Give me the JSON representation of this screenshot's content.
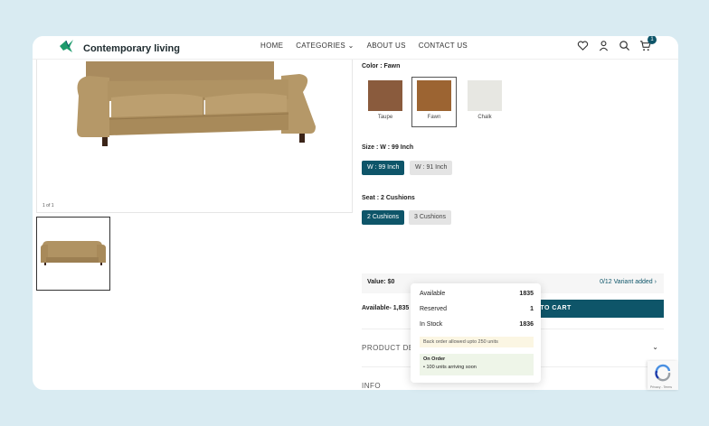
{
  "header": {
    "brand": "Contemporary living",
    "nav": [
      "HOME",
      "CATEGORIES",
      "ABOUT US",
      "CONTACT US"
    ],
    "cart_count": "1",
    "icons": [
      "wishlist-heart-icon",
      "user-icon",
      "search-icon",
      "cart-icon"
    ]
  },
  "gallery": {
    "page_indicator": "1 of 1"
  },
  "color": {
    "label": "Color : Fawn",
    "swatches": [
      {
        "name": "Taupe",
        "hex": "#8a5b3d",
        "selected": false
      },
      {
        "name": "Fawn",
        "hex": "#9c6432",
        "selected": true
      },
      {
        "name": "Chalk",
        "hex": "#e7e7e2",
        "selected": false
      }
    ]
  },
  "size": {
    "label": "Size : W : 99 Inch",
    "options": [
      "W : 99 Inch",
      "W : 91 Inch"
    ]
  },
  "seat": {
    "label": "Seat : 2 Cushions",
    "options": [
      "2 Cushions",
      "3 Cushions"
    ]
  },
  "value": {
    "label": "Value: $0",
    "variants": "0/12 Variant added"
  },
  "availability": {
    "label": "Available- 1,835"
  },
  "add_to_cart": "ADD TO CART",
  "accordion": [
    "PRODUCT DETAILS",
    "INFO"
  ],
  "stock_popover": {
    "rows": [
      {
        "label": "Available",
        "value": "1835"
      },
      {
        "label": "Reserved",
        "value": "1"
      },
      {
        "label": "In Stock",
        "value": "1836"
      }
    ],
    "backorder_note": "Back order allowed upto 250 units",
    "on_order_title": "On Order",
    "on_order_item": "100 units arriving soon"
  },
  "recaptcha_text": "Privacy - Terms",
  "colors": {
    "accent": "#0e5569",
    "background": "#d9ebf2"
  }
}
